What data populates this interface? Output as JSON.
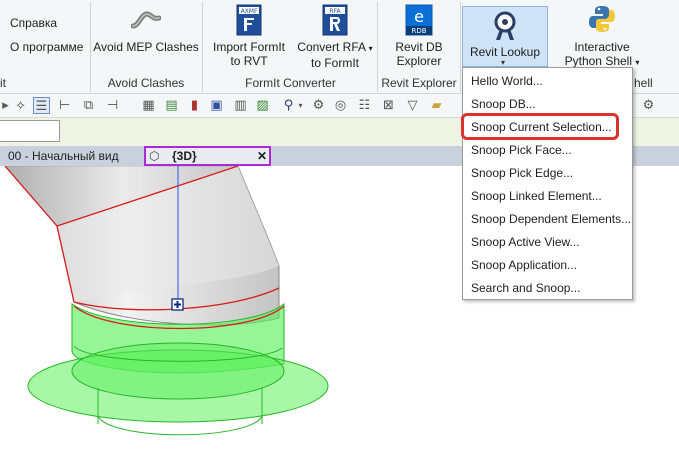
{
  "ribbon": {
    "partial_labels": [
      "Справка",
      "О программе"
    ],
    "left_panel_title_fragment": "it",
    "buttons": {
      "avoid_mep_clashes": "Avoid MEP Clashes",
      "import_formit_l1": "Import FormIt",
      "import_formit_l2": "to RVT",
      "convert_rfa_l1": "Convert RFA",
      "convert_rfa_l2": "to FormIt",
      "revit_db_l1": "Revit DB",
      "revit_db_l2": "Explorer",
      "revit_lookup": "Revit Lookup",
      "python_l1": "Interactive",
      "python_l2": "Python Shell"
    },
    "icon_texts": {
      "axmf": "AXMF",
      "rfa": "RFA",
      "rdb": "RDB",
      "rdb_letter": "e"
    },
    "panel_titles": {
      "avoid_clashes": "Avoid Clashes",
      "formit_converter": "FormIt Converter",
      "revit_explorer": "Revit Explorer",
      "python_fragment": "hell"
    }
  },
  "view_tabs": [
    {
      "label": "00 - Начальный вид"
    },
    {
      "label": "{3D}",
      "active": true
    }
  ],
  "dropdown": {
    "items": [
      "Hello World...",
      "Snoop DB...",
      "Snoop Current Selection...",
      "Snoop Pick Face...",
      "Snoop Pick Edge...",
      "Snoop Linked Element...",
      "Snoop Dependent Elements...",
      "Snoop Active View...",
      "Snoop Application...",
      "Search and Snoop..."
    ],
    "highlighted_index": 2
  },
  "colors": {
    "highlight_box": "#d9342b",
    "active_tab_border": "#a92bd8",
    "options_bar": "#eef3e4",
    "tab_bar": "#c9d2dc",
    "button_active": "#cfe3f7",
    "fitting_green": "#5ef05e"
  }
}
